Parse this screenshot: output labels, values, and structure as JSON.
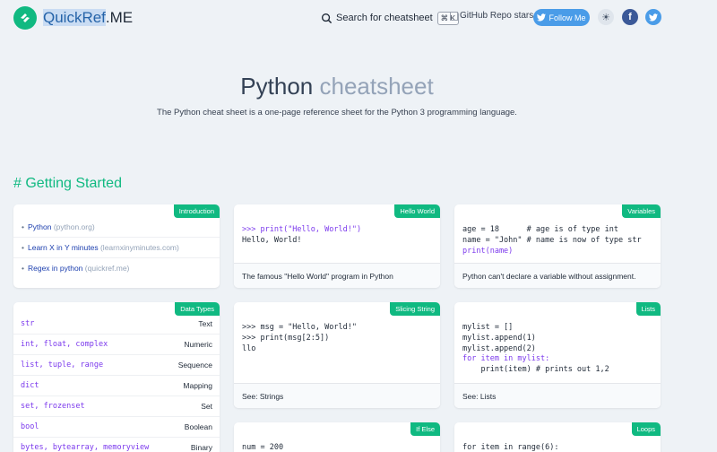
{
  "header": {
    "brand_highlight": "QuickRef",
    "brand_rest": ".ME",
    "search_label": "Search for cheatsheet",
    "search_shortcut": "⌘ K",
    "github_stars_alt": "GitHub Repo stars",
    "follow_label": "Follow Me",
    "theme_icon": "☀",
    "facebook_icon": "f"
  },
  "hero": {
    "title_main": "Python",
    "title_light": "cheatsheet",
    "description": "The Python cheat sheet is a one-page reference sheet for the Python 3 programming language."
  },
  "section": {
    "title": "# Getting Started"
  },
  "cards": {
    "introduction": {
      "tag": "Introduction",
      "links": [
        {
          "text": "Python",
          "hint": "(python.org)"
        },
        {
          "text": "Learn X in Y minutes",
          "hint": "(learnxinyminutes.com)"
        },
        {
          "text": "Regex in python",
          "hint": "(quickref.me)"
        }
      ]
    },
    "hello_world": {
      "tag": "Hello World",
      "line1_prompt": ">>> ",
      "line1_code": "print(\"Hello, World!\")",
      "line2": "Hello, World!",
      "footer": "The famous \"Hello World\" program in Python"
    },
    "variables": {
      "tag": "Variables",
      "line1": "age = 18      # age is of type int",
      "line2": "name = \"John\" # name is now of type str",
      "line3": "print(name)",
      "footer": "Python can't declare a variable without assignment."
    },
    "data_types": {
      "tag": "Data Types",
      "rows": [
        {
          "code": "str",
          "name": "Text"
        },
        {
          "code": "int, float, complex",
          "name": "Numeric"
        },
        {
          "code": "list, tuple, range",
          "name": "Sequence"
        },
        {
          "code": "dict",
          "name": "Mapping"
        },
        {
          "code": "set, frozenset",
          "name": "Set"
        },
        {
          "code": "bool",
          "name": "Boolean"
        },
        {
          "code": "bytes, bytearray, memoryview",
          "name": "Binary"
        }
      ]
    },
    "slicing_string": {
      "tag": "Slicing String",
      "line1": ">>> msg = \"Hello, World!\"",
      "line2": ">>> print(msg[2:5])",
      "line3": "llo",
      "footer": "See: Strings"
    },
    "lists": {
      "tag": "Lists",
      "line1": "mylist = []",
      "line2": "mylist.append(1)",
      "line3": "mylist.append(2)",
      "line4": "for item in mylist:",
      "line5": "    print(item) # prints out 1,2",
      "footer": "See: Lists"
    },
    "if_else": {
      "tag": "If Else",
      "line1": "num = 200"
    },
    "loops": {
      "tag": "Loops",
      "line1": "for item in range(6):"
    }
  },
  "colors": {
    "accent": "#10b981",
    "twitter": "#4a9ce8",
    "facebook": "#3b5998",
    "background": "#eef2f6"
  }
}
